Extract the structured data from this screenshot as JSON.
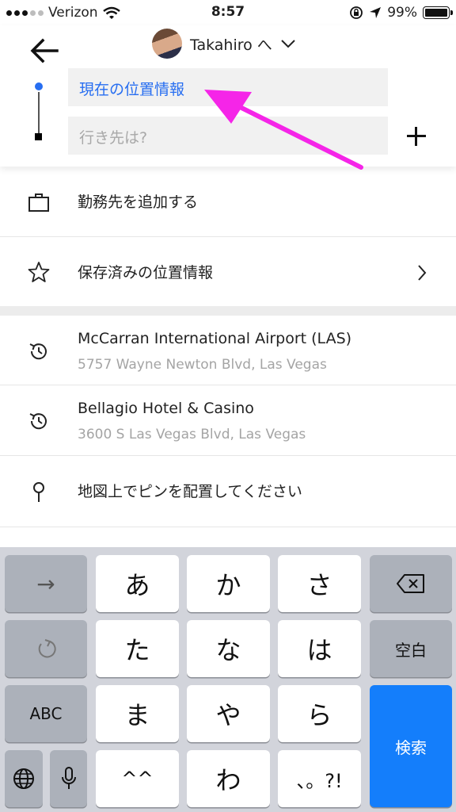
{
  "status_bar": {
    "carrier": "Verizon",
    "time": "8:57",
    "battery": "99%",
    "icons": [
      "signal-icon",
      "wifi-icon",
      "rotation-lock-icon",
      "location-arrow-icon",
      "battery-icon"
    ]
  },
  "header": {
    "back_icon": "arrow-left-icon",
    "user_name": "Takahiro へ",
    "pickup_value": "現在の位置情報",
    "destination_placeholder": "行き先は?",
    "add_stop_icon": "plus-icon"
  },
  "annotation_color": "#f525e8",
  "accent_color": "#276ef1",
  "list": {
    "add_work": "勤務先を追加する",
    "saved_places": "保存済みの位置情報",
    "recent": [
      {
        "title": "McCarran International Airport (LAS)",
        "subtitle": "5757 Wayne Newton Blvd, Las Vegas"
      },
      {
        "title": "Bellagio Hotel & Casino",
        "subtitle": "3600 S Las Vegas Blvd, Las Vegas"
      }
    ],
    "set_pin": "地図上でピンを配置してください"
  },
  "keyboard": {
    "row1": [
      "→",
      "あ",
      "か",
      "さ"
    ],
    "row2": [
      "た",
      "な",
      "は",
      "空白"
    ],
    "row3": [
      "ABC",
      "ま",
      "や",
      "ら",
      "検索"
    ],
    "row4": [
      "^^",
      "わ",
      "、。?!"
    ],
    "special_icons": [
      "backspace-icon",
      "undo-icon",
      "globe-icon",
      "microphone-icon"
    ]
  }
}
